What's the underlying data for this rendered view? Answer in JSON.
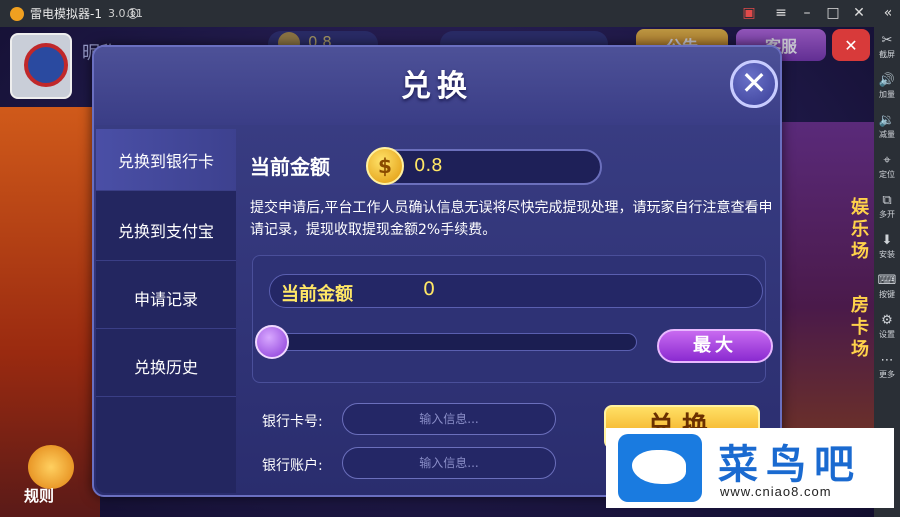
{
  "titlebar": {
    "app_name": "雷电模拟器-1",
    "version": "3.0.11"
  },
  "emulator_sidebar": [
    {
      "icon": "scissors-icon",
      "glyph": "✂",
      "label": "截屏"
    },
    {
      "icon": "volume-up-icon",
      "glyph": "🔊",
      "label": "加量"
    },
    {
      "icon": "volume-down-icon",
      "glyph": "🔉",
      "label": "减量"
    },
    {
      "icon": "location-icon",
      "glyph": "⌖",
      "label": "定位"
    },
    {
      "icon": "multi-open-icon",
      "glyph": "⧉",
      "label": "多开"
    },
    {
      "icon": "apk-install-icon",
      "glyph": "⬇",
      "label": "安装"
    },
    {
      "icon": "keyboard-icon",
      "glyph": "⌨",
      "label": "按键"
    },
    {
      "icon": "settings-icon",
      "glyph": "⚙",
      "label": "设置"
    },
    {
      "icon": "more-icon",
      "glyph": "⋯",
      "label": "更多"
    }
  ],
  "background": {
    "nickname": "昵称:test",
    "gold_value": "0.8",
    "notice_button": "公告",
    "service_button": "客服",
    "rules_label": "规则"
  },
  "dialog": {
    "title": "兑换",
    "menu": [
      {
        "label": "兑换到银行卡",
        "active": true
      },
      {
        "label": "兑换到支付宝",
        "active": false
      },
      {
        "label": "申请记录",
        "active": false
      },
      {
        "label": "兑换历史",
        "active": false
      }
    ],
    "current_amount_label": "当前金额",
    "current_amount_value": "0.8",
    "coin_symbol": "$",
    "notice": "提交申请后,平台工作人员确认信息无误将尽快完成提现处理，请玩家自行注意查看申请记录，提现收取提现金额2%手续费。",
    "exchange_amount_label": "当前金额",
    "exchange_amount_value": "0",
    "slider_value": 0,
    "max_button": "最大",
    "bank_card_label": "银行卡号:",
    "bank_card_placeholder": "输入信息...",
    "bank_account_label": "银行账户:",
    "bank_account_placeholder": "输入信息...",
    "submit_button": "兑换"
  },
  "watermark": {
    "title": "菜鸟吧",
    "url": "www.cniao8.com"
  }
}
